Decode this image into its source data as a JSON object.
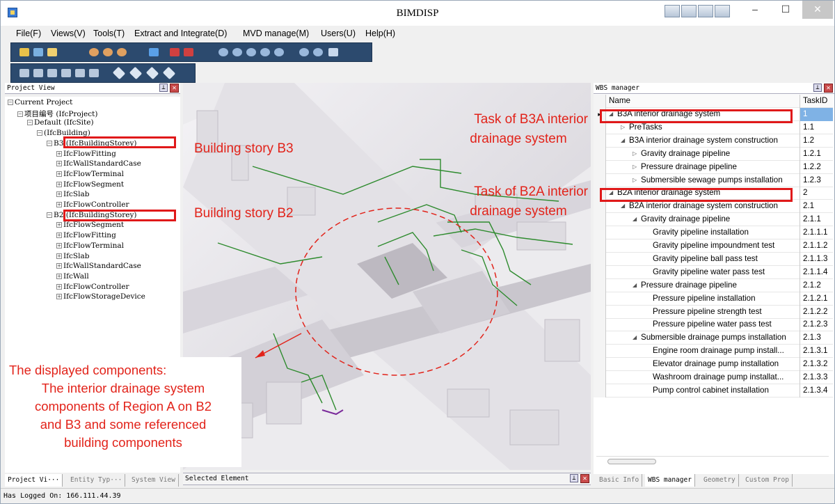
{
  "window": {
    "title": "BIMDISP"
  },
  "menu": [
    "File(F)",
    "Views(V)",
    "Tools(T)",
    "Extract and Integrate(D)",
    "MVD manage(M)",
    "Users(U)",
    "Help(H)"
  ],
  "project_view": {
    "title": "Project View",
    "tree": [
      {
        "label": "Current Project",
        "level": 0,
        "expander": "−"
      },
      {
        "label": "项目编号 (IfcProject)",
        "level": 1,
        "expander": "−"
      },
      {
        "label": "Default (IfcSite)",
        "level": 2,
        "expander": "−"
      },
      {
        "label": "(IfcBuilding)",
        "level": 3,
        "expander": "−"
      },
      {
        "label": "B3 (IfcBuildingStorey)",
        "level": 4,
        "expander": "−"
      },
      {
        "label": "IfcFlowFitting",
        "level": 5,
        "expander": "+"
      },
      {
        "label": "IfcWallStandardCase",
        "level": 5,
        "expander": "+"
      },
      {
        "label": "IfcFlowTerminal",
        "level": 5,
        "expander": "+"
      },
      {
        "label": "IfcFlowSegment",
        "level": 5,
        "expander": "+"
      },
      {
        "label": "IfcSlab",
        "level": 5,
        "expander": "+"
      },
      {
        "label": "IfcFlowController",
        "level": 5,
        "expander": "+"
      },
      {
        "label": "B2 (IfcBuildingStorey)",
        "level": 4,
        "expander": "−"
      },
      {
        "label": "IfcFlowSegment",
        "level": 5,
        "expander": "+"
      },
      {
        "label": "IfcFlowFitting",
        "level": 5,
        "expander": "+"
      },
      {
        "label": "IfcFlowTerminal",
        "level": 5,
        "expander": "+"
      },
      {
        "label": "IfcSlab",
        "level": 5,
        "expander": "+"
      },
      {
        "label": "IfcWallStandardCase",
        "level": 5,
        "expander": "+"
      },
      {
        "label": "IfcWall",
        "level": 5,
        "expander": "+"
      },
      {
        "label": "IfcFlowController",
        "level": 5,
        "expander": "+"
      },
      {
        "label": "IfcFlowStorageDevice",
        "level": 5,
        "expander": "+"
      }
    ],
    "tabs": [
      "Project Vi···",
      "Entity Typ···",
      "System View"
    ]
  },
  "annotations": {
    "story_b3": "Building story B3",
    "story_b2": "Building story B2",
    "task_b3a_1": "Task of B3A interior",
    "task_b3a_2": "drainage system",
    "task_b2a_1": "Task of B2A interior",
    "task_b2a_2": "drainage system",
    "components": [
      "The displayed components:",
      "The  interior drainage system",
      "components of Region A on B2",
      "and B3 and some referenced",
      "building components"
    ]
  },
  "selected_element": {
    "title": "Selected Element"
  },
  "wbs": {
    "title": "WBS manager",
    "col_name": "Name",
    "col_id": "TaskID",
    "rows": [
      {
        "name": "B3A interior drainage system",
        "id": "1",
        "level": 0,
        "exp": "down",
        "selected": true
      },
      {
        "name": "PreTasks",
        "id": "1.1",
        "level": 1,
        "exp": "right"
      },
      {
        "name": "B3A interior drainage system construction",
        "id": "1.2",
        "level": 1,
        "exp": "down"
      },
      {
        "name": "Gravity drainage pipeline",
        "id": "1.2.1",
        "level": 2,
        "exp": "right"
      },
      {
        "name": "Pressure drainage pipeline",
        "id": "1.2.2",
        "level": 2,
        "exp": "right"
      },
      {
        "name": "Submersible sewage pumps installation",
        "id": "1.2.3",
        "level": 2,
        "exp": "right"
      },
      {
        "name": "B2A interior drainage system",
        "id": "2",
        "level": 0,
        "exp": "down"
      },
      {
        "name": "B2A interior drainage system construction",
        "id": "2.1",
        "level": 1,
        "exp": "down"
      },
      {
        "name": "Gravity drainage pipeline",
        "id": "2.1.1",
        "level": 2,
        "exp": "down"
      },
      {
        "name": "Gravity pipeline installation",
        "id": "2.1.1.1",
        "level": 3,
        "exp": ""
      },
      {
        "name": "Gravity pipeline impoundment test",
        "id": "2.1.1.2",
        "level": 3,
        "exp": ""
      },
      {
        "name": "Gravity pipeline ball pass test",
        "id": "2.1.1.3",
        "level": 3,
        "exp": ""
      },
      {
        "name": "Gravity pipeline water pass test",
        "id": "2.1.1.4",
        "level": 3,
        "exp": ""
      },
      {
        "name": "Pressure drainage pipeline",
        "id": "2.1.2",
        "level": 2,
        "exp": "down"
      },
      {
        "name": "Pressure pipeline installation",
        "id": "2.1.2.1",
        "level": 3,
        "exp": ""
      },
      {
        "name": "Pressure pipeline strength test",
        "id": "2.1.2.2",
        "level": 3,
        "exp": ""
      },
      {
        "name": "Pressure pipeline water pass test",
        "id": "2.1.2.3",
        "level": 3,
        "exp": ""
      },
      {
        "name": "Submersible drainage pumps installation",
        "id": "2.1.3",
        "level": 2,
        "exp": "down"
      },
      {
        "name": "Engine room drainage pump install...",
        "id": "2.1.3.1",
        "level": 3,
        "exp": ""
      },
      {
        "name": "Elevator drainage pump installation",
        "id": "2.1.3.2",
        "level": 3,
        "exp": ""
      },
      {
        "name": "Washroom drainage pump installat...",
        "id": "2.1.3.3",
        "level": 3,
        "exp": ""
      },
      {
        "name": "Pump control cabinet installation",
        "id": "2.1.3.4",
        "level": 3,
        "exp": ""
      }
    ],
    "tabs": [
      "Basic Info",
      "WBS manager",
      "Geometry",
      "Custom Prop"
    ]
  },
  "status": {
    "text": "Has Logged On: 166.111.44.39"
  },
  "colors": {
    "accent_red": "#e2231a",
    "toolbar": "#2c4a6e",
    "pipe_green": "#2e8b2e",
    "selected_row": "#7fb2e5"
  }
}
